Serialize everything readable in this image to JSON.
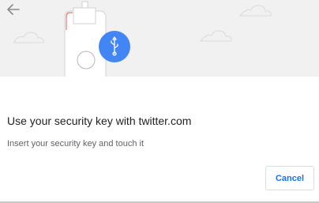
{
  "header": {
    "back_icon": "arrow-left-icon"
  },
  "illustration": {
    "key_icon": "security-key-icon",
    "usb_icon": "usb-icon",
    "accent_color": "#4285f4"
  },
  "content": {
    "title": "Use your security key with twitter.com",
    "subtitle": "Insert your security key and touch it"
  },
  "actions": {
    "cancel_label": "Cancel"
  }
}
